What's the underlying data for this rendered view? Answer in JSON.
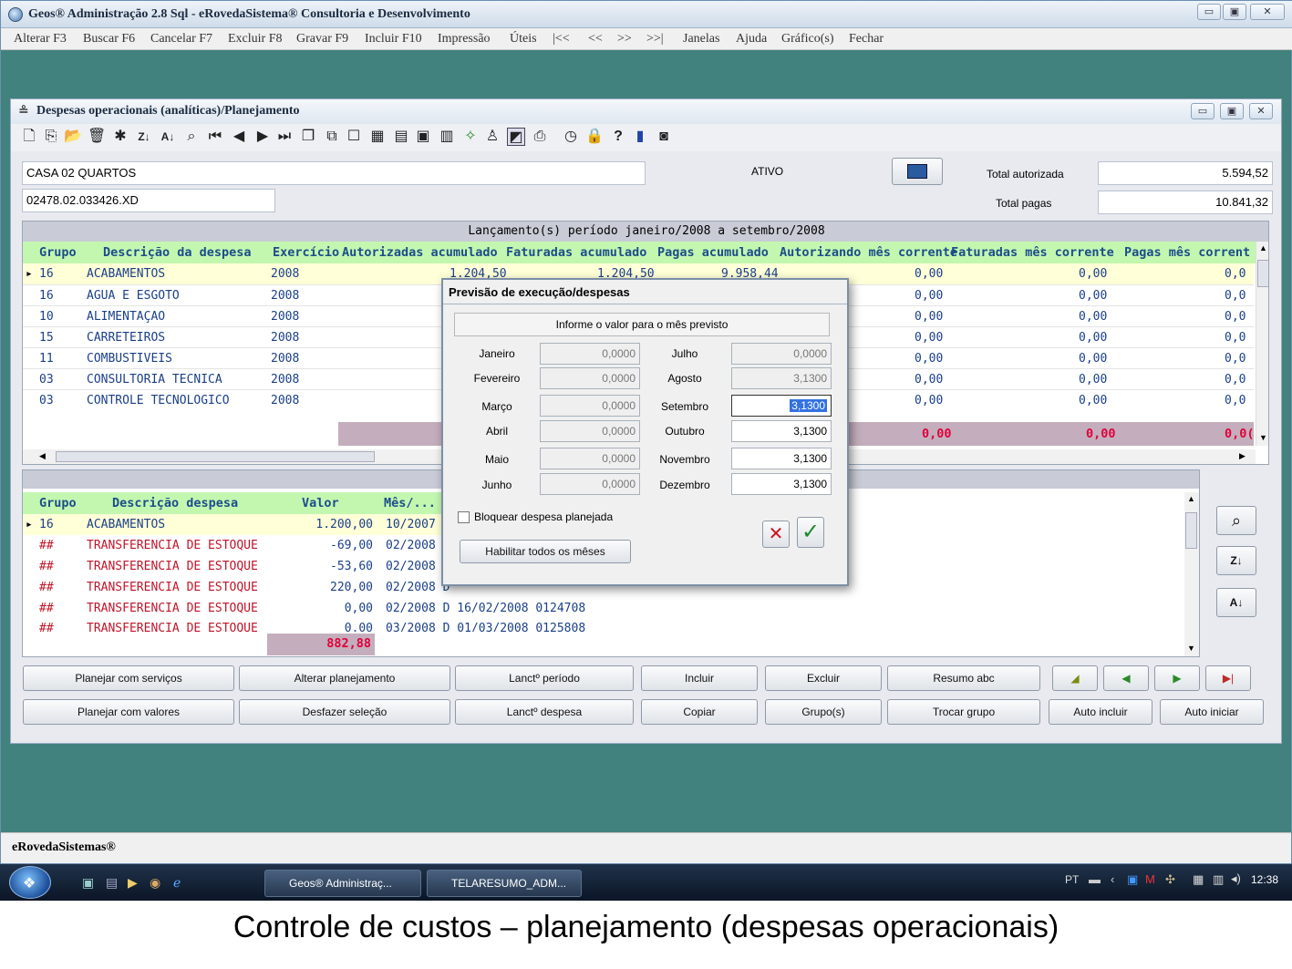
{
  "app": {
    "title": "Geos® Administração 2.8 Sql - eRovedaSistema® Consultoria e Desenvolvimento",
    "window_controls": [
      "▭",
      "▣",
      "✕"
    ],
    "status_bar": "eRovedaSistemas®"
  },
  "menu": [
    "Alterar F3",
    "Buscar F6",
    "Cancelar F7",
    "Excluir F8",
    "Gravar F9",
    "Incluir F10",
    "Impressão",
    "Úteis",
    "|<<",
    "<<",
    ">>",
    ">>|",
    "Janelas",
    "Ajuda",
    "Gráfico(s)",
    "Fechar"
  ],
  "child": {
    "title": "Despesas operacionais (analíticas)/Planejamento",
    "toolbar_icons": [
      "new-icon",
      "copy-icon",
      "open-icon",
      "delete-icon",
      "magic-icon",
      "sort-za-icon",
      "sort-az-icon",
      "search-icon",
      "first-icon",
      "prev-icon",
      "next-icon",
      "last-icon",
      "window-icon",
      "windows-icon",
      "checkbox-icon",
      "grid-icon",
      "table-icon",
      "calc-icon",
      "calendar-icon",
      "wand-icon",
      "person-icon",
      "chart-icon",
      "printer-icon",
      "clock-icon",
      "lock-icon",
      "help-icon",
      "bar-chart-icon",
      "camera-icon"
    ]
  },
  "header": {
    "project_name": "CASA 02 QUARTOS",
    "project_code": "02478.02.033426.XD",
    "status": "ATIVO",
    "total_autorizada_label": "Total autorizada",
    "total_autorizada_value": "5.594,52",
    "total_pagas_label": "Total pagas",
    "total_pagas_value": "10.841,32"
  },
  "upper_grid": {
    "caption": "Lançamento(s) período janeiro/2008 a setembro/2008",
    "columns": [
      "Grupo",
      "Descrição da despesa",
      "Exercício",
      "Autorizadas acumulado",
      "Faturadas acumulado",
      "Pagas acumulado",
      "Autorizando mês corrente",
      "Faturadas mês corrente",
      "Pagas mês corrente"
    ],
    "rows": [
      {
        "grupo": "16",
        "desc": "ACABAMENTOS",
        "exercicio": "2008",
        "aut_acum": "1.204,50",
        "fat_acum": "1.204,50",
        "pag_acum": "9.958,44",
        "aut_mes": "0,00",
        "fat_mes": "0,00",
        "pag_mes": "0,0"
      },
      {
        "grupo": "16",
        "desc": "ÁGUA E ESGOTO",
        "exercicio": "2008",
        "aut_mes": "0,00",
        "fat_mes": "0,00",
        "pag_mes": "0,0"
      },
      {
        "grupo": "10",
        "desc": "ALIMENTAÇÃO",
        "exercicio": "2008",
        "aut_mes": "0,00",
        "fat_mes": "0,00",
        "pag_mes": "0,0"
      },
      {
        "grupo": "15",
        "desc": "CARRETEIROS",
        "exercicio": "2008",
        "aut_mes": "0,00",
        "fat_mes": "0,00",
        "pag_mes": "0,0"
      },
      {
        "grupo": "11",
        "desc": "COMBUSTIVEIS",
        "exercicio": "2008",
        "aut_mes": "0,00",
        "fat_mes": "0,00",
        "pag_mes": "0,0"
      },
      {
        "grupo": "03",
        "desc": "CONSULTORIA TECNICA",
        "exercicio": "2008",
        "aut_mes": "0,00",
        "fat_mes": "0,00",
        "pag_mes": "0,0"
      },
      {
        "grupo": "03",
        "desc": "CONTROLE TECNOLÓGICO",
        "exercicio": "2008",
        "aut_mes": "0,00",
        "fat_mes": "0,00",
        "pag_mes": "0,0"
      }
    ],
    "totals": {
      "aut_mes": "0,00",
      "fat_mes": "0,00",
      "pag_mes": "0,0("
    }
  },
  "lower_grid": {
    "columns": [
      "Grupo",
      "Descrição despesa",
      "Valor",
      "Mês/..."
    ],
    "rows": [
      {
        "grupo": "16",
        "desc": "ACABAMENTOS",
        "valor": "1.200,00",
        "mes": "10/2007 D"
      },
      {
        "grupo": "##",
        "desc": "TRANSFERÊNCIA DE ESTOQUE",
        "valor": "-69,00",
        "mes": "02/2008 D"
      },
      {
        "grupo": "##",
        "desc": "TRANSFERÊNCIA DE ESTOQUE",
        "valor": "-53,60",
        "mes": "02/2008 D"
      },
      {
        "grupo": "##",
        "desc": "TRANSFERÊNCIA DE ESTOQUE",
        "valor": "220,00",
        "mes": "02/2008 D"
      },
      {
        "grupo": "##",
        "desc": "TRANSFERÊNCIA DE ESTOQUE",
        "valor": "0,00",
        "mes": "02/2008 D 16/02/2008 0124708"
      },
      {
        "grupo": "##",
        "desc": "TRANSFERÊNCIA DE ESTOQUE",
        "valor": "0,00",
        "mes": "03/2008 D 01/03/2008 0125808"
      }
    ],
    "total": "882,88"
  },
  "buttons_row1": [
    "Planejar com serviços",
    "Alterar planejamento",
    "Lanctº período",
    "Incluir",
    "Excluir",
    "Resumo abc"
  ],
  "buttons_row2": [
    "Planejar com valores",
    "Desfazer seleção",
    "Lanctº despesa",
    "Copiar",
    "Grupo(s)",
    "Trocar grupo",
    "Auto incluir",
    "Auto iniciar"
  ],
  "dialog": {
    "title": "Previsão de execução/despesas",
    "prompt": "Informe o valor para o mês previsto",
    "months": [
      {
        "label": "Janeiro",
        "value": "0,0000"
      },
      {
        "label": "Fevereiro",
        "value": "0,0000"
      },
      {
        "label": "Março",
        "value": "0,0000"
      },
      {
        "label": "Abril",
        "value": "0,0000"
      },
      {
        "label": "Maio",
        "value": "0,0000"
      },
      {
        "label": "Junho",
        "value": "0,0000"
      },
      {
        "label": "Julho",
        "value": "0,0000"
      },
      {
        "label": "Agosto",
        "value": "3,1300"
      },
      {
        "label": "Setembro",
        "value": "3,1300"
      },
      {
        "label": "Outubro",
        "value": "3,1300"
      },
      {
        "label": "Novembro",
        "value": "3,1300"
      },
      {
        "label": "Dezembro",
        "value": "3,1300"
      }
    ],
    "block_label": "Bloquear despesa planejada",
    "enable_all_label": "Habilitar todos os mêses"
  },
  "taskbar": {
    "tasks": [
      "Geos® Administraç...",
      "TELARESUMO_ADM..."
    ],
    "lang": "PT",
    "clock": "12:38"
  },
  "caption": "Controle de  custos – planejamento (despesas operacionais)",
  "colors": {
    "teal_background": "#42827e",
    "header_green": "#c3f7b0",
    "total_red": "#e0003a",
    "ok_green": "#1c8a2a",
    "cancel_red": "#cc1122"
  }
}
